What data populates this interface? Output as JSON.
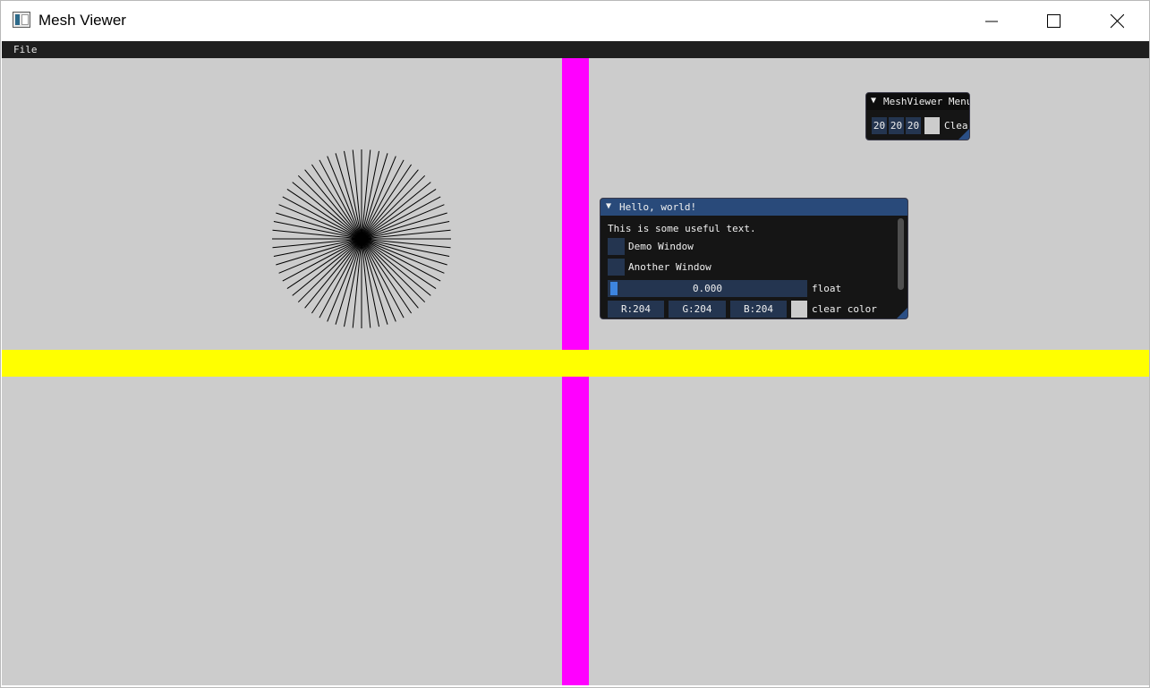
{
  "window": {
    "title": "Mesh Viewer"
  },
  "menu": {
    "file": "File"
  },
  "hello_window": {
    "title": "Hello, world!",
    "text": "This is some useful text.",
    "checkboxes": [
      {
        "label": "Demo Window",
        "checked": false
      },
      {
        "label": "Another Window",
        "checked": false
      }
    ],
    "slider": {
      "value": "0.000",
      "label": "float",
      "fraction": 0.0
    },
    "color": {
      "r": "R:204",
      "g": "G:204",
      "b": "B:204",
      "label": "clear color",
      "swatch": "#cccccc"
    }
  },
  "meshviewer_window": {
    "title": "MeshViewer Menu",
    "values": [
      "20",
      "20",
      "20"
    ],
    "clear_label": "Clear",
    "swatch": "#cccccc"
  },
  "viewport": {
    "background": "#cccccc",
    "vertical_bar_color": "#ff00ff",
    "horizontal_bar_color": "#ffff00"
  }
}
